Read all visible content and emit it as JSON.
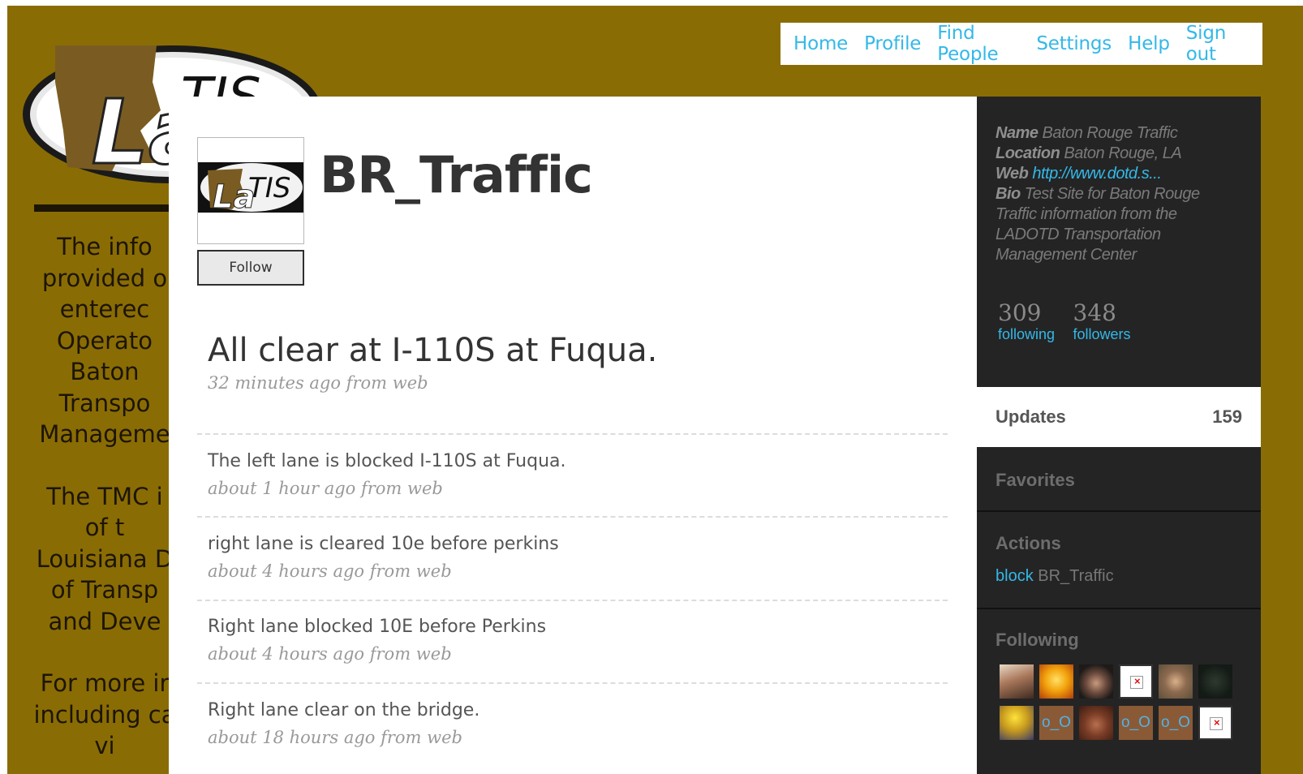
{
  "colors": {
    "background_brand": "#8a6c05",
    "link": "#34b8e8",
    "sidebar": "#242424"
  },
  "background_text": [
    "The info",
    "provided o",
    "enterec",
    "Operato",
    "Baton",
    "Transpo",
    "Manageme",
    "The TMC i",
    "of t",
    "Louisiana D",
    "of Transp",
    "and Deve",
    "For more ir",
    "including ca",
    "vi"
  ],
  "logo": {
    "letters": "La TIS"
  },
  "nav": {
    "items": [
      "Home",
      "Profile",
      "Find People",
      "Settings",
      "Help",
      "Sign out"
    ]
  },
  "profile": {
    "screen_name": "BR_Traffic",
    "avatar_text": "La TIS",
    "follow_label": "Follow"
  },
  "latest": {
    "text": "All clear at I-110S at Fuqua.",
    "meta": "32 minutes ago from web"
  },
  "updates": [
    {
      "text": "The left lane is blocked I-110S at Fuqua.",
      "meta": "about 1 hour ago from web"
    },
    {
      "text": "right lane is cleared 10e before perkins",
      "meta": "about 4 hours ago from web"
    },
    {
      "text": "Right lane blocked 10E before Perkins",
      "meta": "about 4 hours ago from web"
    },
    {
      "text": "Right lane clear on the bridge.",
      "meta": "about 18 hours ago from web"
    }
  ],
  "sidebar": {
    "name_label": "Name",
    "name": "Baton Rouge Traffic",
    "location_label": "Location",
    "location": "Baton Rouge, LA",
    "web_label": "Web",
    "web": "http://www.dotd.s...",
    "bio_label": "Bio",
    "bio": "Test Site for Baton Rouge Traffic information from the LADOTD Transportation Management Center",
    "following_count": "309",
    "following_label": "following",
    "followers_count": "348",
    "followers_label": "followers",
    "updates_label": "Updates",
    "updates_count": "159",
    "favorites_label": "Favorites",
    "actions_label": "Actions",
    "block_label": "block",
    "block_user": "BR_Traffic",
    "following_heading": "Following",
    "thumb_text": "o_O"
  }
}
